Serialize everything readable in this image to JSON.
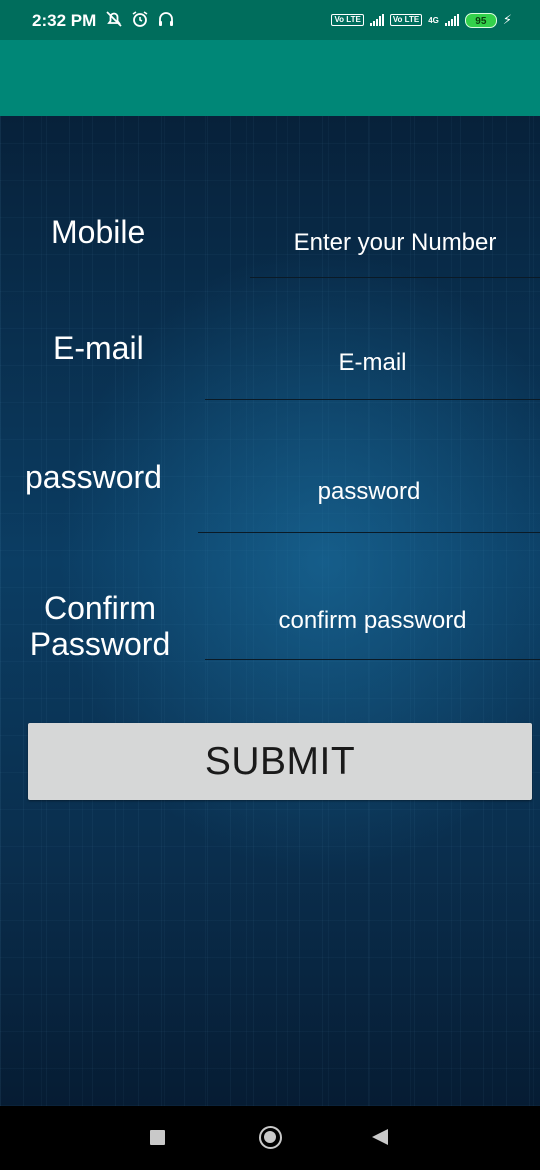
{
  "status_bar": {
    "time": "2:32 PM",
    "left_icons": [
      "notification-muted-icon",
      "alarm-icon",
      "headphones-icon"
    ],
    "volte_1": "Vo LTE",
    "volte_2": "Vo LTE",
    "network_type": "4G",
    "battery": "95",
    "charging_icon": "bolt-icon"
  },
  "form": {
    "mobile": {
      "label": "Mobile",
      "placeholder": "Enter your Number"
    },
    "email": {
      "label": "E-mail",
      "placeholder": "E-mail"
    },
    "password": {
      "label": "password",
      "placeholder": "password"
    },
    "confirm_password": {
      "label": "Confirm Password",
      "placeholder": "confirm password"
    },
    "submit_label": "SUBMIT"
  },
  "nav_bar": {
    "icons": [
      "recent-apps-icon",
      "home-icon",
      "back-icon"
    ]
  },
  "colors": {
    "status_bar": "#006d5c",
    "app_bar": "#008777",
    "button": "#d6d7d7",
    "background": "#0b3d63"
  }
}
